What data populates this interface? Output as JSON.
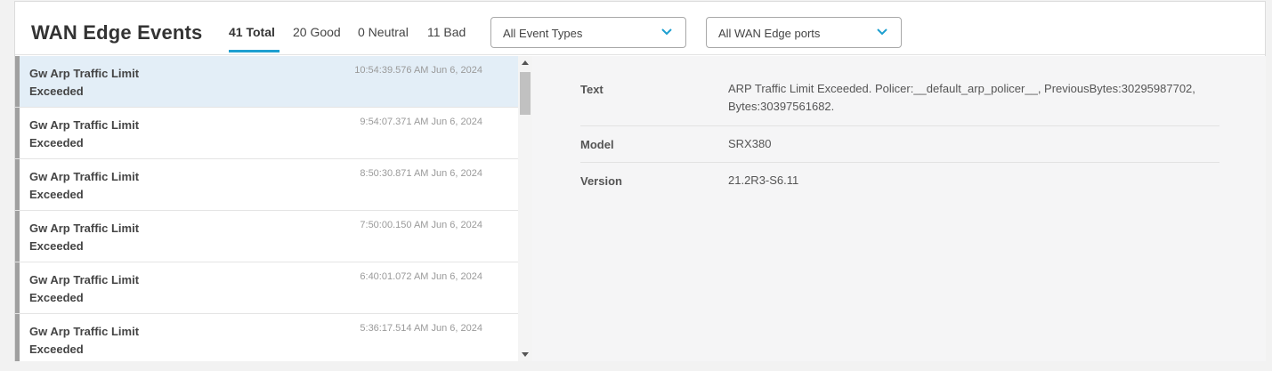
{
  "header": {
    "title": "WAN Edge Events",
    "tabs": [
      {
        "label": "41 Total"
      },
      {
        "label": "20 Good"
      },
      {
        "label": "0 Neutral"
      },
      {
        "label": "11 Bad"
      }
    ],
    "event_type_select": {
      "value": "All Event Types"
    },
    "port_select": {
      "value": "All WAN Edge ports"
    }
  },
  "events": [
    {
      "name": "Gw Arp Traffic Limit Exceeded",
      "time": "10:54:39.576 AM Jun 6, 2024"
    },
    {
      "name": "Gw Arp Traffic Limit Exceeded",
      "time": "9:54:07.371 AM Jun 6, 2024"
    },
    {
      "name": "Gw Arp Traffic Limit Exceeded",
      "time": "8:50:30.871 AM Jun 6, 2024"
    },
    {
      "name": "Gw Arp Traffic Limit Exceeded",
      "time": "7:50:00.150 AM Jun 6, 2024"
    },
    {
      "name": "Gw Arp Traffic Limit Exceeded",
      "time": "6:40:01.072 AM Jun 6, 2024"
    },
    {
      "name": "Gw Arp Traffic Limit Exceeded",
      "time": "5:36:17.514 AM Jun 6, 2024"
    }
  ],
  "details": [
    {
      "label": "Text",
      "value": "ARP Traffic Limit Exceeded. Policer:__default_arp_policer__, PreviousBytes:30295987702, Bytes:30397561682."
    },
    {
      "label": "Model",
      "value": "SRX380"
    },
    {
      "label": "Version",
      "value": "21.2R3-S6.11"
    }
  ],
  "colors": {
    "accent": "#1e9fd0",
    "selected_row": "#e3eef7",
    "status_bar": "#a0a0a0"
  },
  "icons": {
    "select_chevron": "chevron-down-icon"
  }
}
